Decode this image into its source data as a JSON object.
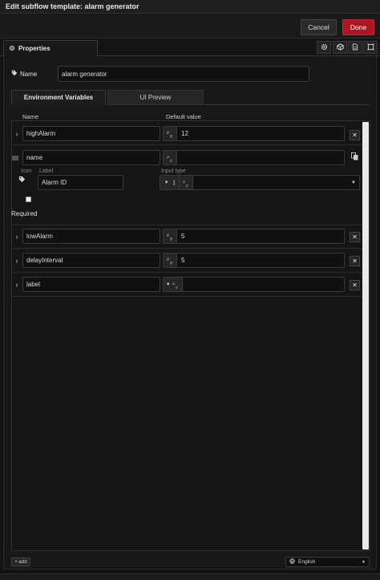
{
  "window": {
    "title": "Edit subflow template: alarm generator"
  },
  "actions": {
    "cancel_label": "Cancel",
    "done_label": "Done"
  },
  "tabs": {
    "properties_label": "Properties"
  },
  "properties": {
    "name_label": "Name",
    "name_value": "alarm generator"
  },
  "subtabs": {
    "env_label": "Environment Variables",
    "preview_label": "UI Preview"
  },
  "columns": {
    "name": "Name",
    "default_value": "Default value"
  },
  "env": {
    "row1": {
      "name": "highAlarm",
      "type": "0-9",
      "value": "12"
    },
    "row2": {
      "name": "name",
      "type": "a-z",
      "value": "",
      "icon_label": "Icon",
      "label_label": "Label",
      "label_value": "Alarm ID",
      "input_type_label": "Input type",
      "required_label": "Required"
    },
    "row3": {
      "name": "lowAlarm",
      "type": "0-9",
      "value": "5"
    },
    "row4": {
      "name": "delayInterval",
      "type": "0-9",
      "value": "5"
    },
    "row5": {
      "name": "label",
      "type": "a-z",
      "value": ""
    }
  },
  "footer": {
    "add_label": "add",
    "language": "English"
  },
  "colors": {
    "done": "#ad1625",
    "background": "#121212",
    "panel": "#181818"
  }
}
